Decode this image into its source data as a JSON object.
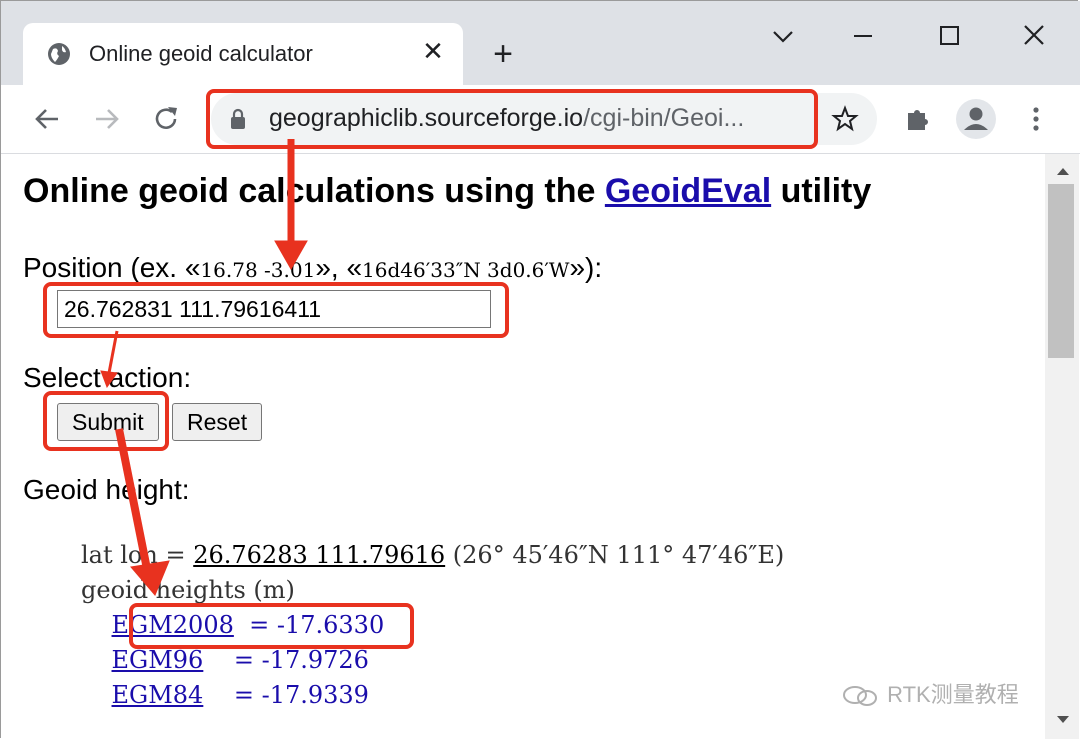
{
  "tab": {
    "title": "Online geoid calculator"
  },
  "omnibox": {
    "url_host": "geographiclib.sourceforge.io",
    "url_path": "/cgi-bin/Geoi..."
  },
  "page": {
    "heading_prefix": "Online geoid calculations using the ",
    "heading_link": "GeoidEval",
    "heading_suffix": " utility",
    "position_label": "Position (ex. «",
    "example1": "16.78 -3.01",
    "mid": "», «",
    "example2": "16d46′33″N 3d0.6′W",
    "position_end": "»):",
    "position_value": "26.762831 111.79616411",
    "select_action": "Select action:",
    "submit": "Submit",
    "reset": "Reset",
    "geoid_height_label": "Geoid height:",
    "latlon_prefix": "lat lon = ",
    "latlon_value": "26.76283 111.79616",
    "latlon_dms": " (26° 45′46″N 111° 47′46″E)",
    "heights_label": "geoid heights (m)",
    "models": [
      {
        "name": "EGM2008",
        "sep": "  = ",
        "value": "-17.6330"
      },
      {
        "name": "EGM96",
        "sep": "    = ",
        "value": "-17.9726"
      },
      {
        "name": "EGM84",
        "sep": "    = ",
        "value": "-17.9339"
      }
    ]
  },
  "watermark": {
    "text": "RTK测量教程"
  },
  "colors": {
    "accent_red": "#e8321f",
    "link": "#1a0dab",
    "tabstrip": "#dee1e6"
  },
  "icons": [
    "globe-icon",
    "close-icon",
    "plus-icon",
    "chevron-down-icon",
    "minimize-icon",
    "maximize-icon",
    "back-arrow-icon",
    "forward-arrow-icon",
    "reload-icon",
    "lock-icon",
    "star-icon",
    "puzzle-icon",
    "profile-icon",
    "kebab-menu-icon"
  ]
}
